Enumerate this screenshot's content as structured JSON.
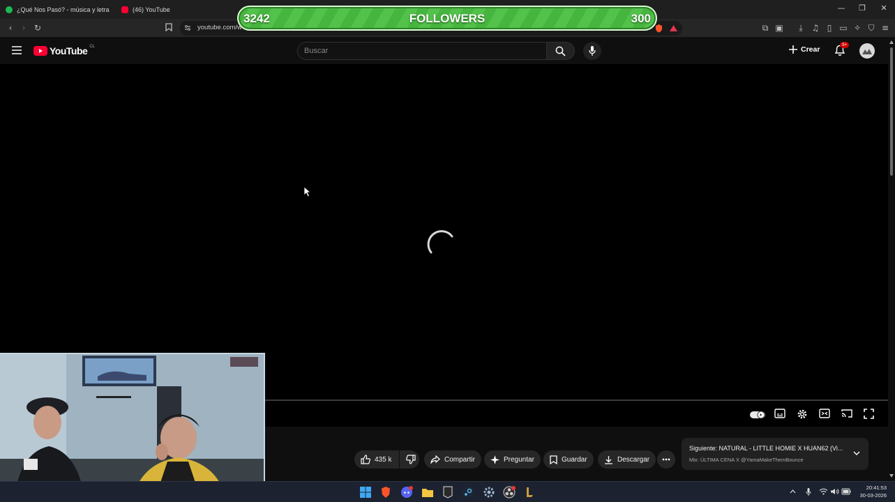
{
  "browser": {
    "tabs": [
      {
        "title": "¿Qué Nos Pasó? - música y letra de A",
        "favicon_color": "#1db954"
      },
      {
        "title": "(46) YouTube",
        "favicon_color": "#ff0033"
      }
    ],
    "url": "youtube.com/w"
  },
  "overlay": {
    "followers_current": "3242",
    "followers_label": "FOLLOWERS",
    "followers_goal": "300"
  },
  "youtube": {
    "logo_text": "YouTube",
    "country_code": "CL",
    "search_placeholder": "Buscar",
    "create_label": "Crear",
    "notifications_badge": "9+"
  },
  "actions": {
    "likes": "435 k",
    "share": "Compartir",
    "ask": "Preguntar",
    "save": "Guardar",
    "download": "Descargar"
  },
  "up_next": {
    "title": "Siguiente: NATURAL - LITTLE HOMIE X HUAN62 (Vi...",
    "subtitle": "Mix: ÚLTIMA CENA X @YamaMakeThemBounce"
  },
  "system": {
    "time": "20:41:53",
    "date": "30-03-2026"
  },
  "colors": {
    "youtube_red": "#ff0033",
    "followers_green": "#46b53f",
    "background": "#0f0f0f"
  }
}
